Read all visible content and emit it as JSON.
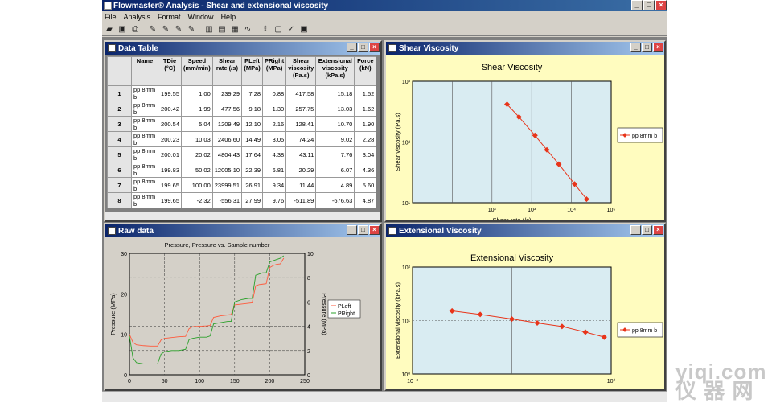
{
  "app": {
    "title": "Flowmaster® Analysis - Shear and extensional viscosity",
    "menu": [
      "File",
      "Analysis",
      "Format",
      "Window",
      "Help"
    ],
    "toolbar_icons": [
      "open-icon",
      "save-icon",
      "print-icon",
      "sep",
      "tool-a-icon",
      "tool-b-icon",
      "tool-c-icon",
      "tool-d-icon",
      "sep",
      "chart-icon",
      "table-icon",
      "grid-icon",
      "curves-icon",
      "sep",
      "export-icon",
      "dialog-icon",
      "check-icon",
      "disk-icon"
    ]
  },
  "data_table": {
    "title": "Data Table",
    "headers": [
      "",
      "Name",
      "TDie (°C)",
      "Speed (mm/min)",
      "Shear rate (/s)",
      "PLeft (MPa)",
      "PRight (MPa)",
      "Shear viscosity (Pa.s)",
      "Extensional viscosity (kPa.s)",
      "Force (kN)"
    ],
    "rows": [
      [
        "1",
        "pp 8mm b",
        "199.55",
        "1.00",
        "239.29",
        "7.28",
        "0.88",
        "417.58",
        "15.18",
        "1.52"
      ],
      [
        "2",
        "pp 8mm b",
        "200.42",
        "1.99",
        "477.56",
        "9.18",
        "1.30",
        "257.75",
        "13.03",
        "1.62"
      ],
      [
        "3",
        "pp 8mm b",
        "200.54",
        "5.04",
        "1209.49",
        "12.10",
        "2.16",
        "128.41",
        "10.70",
        "1.90"
      ],
      [
        "4",
        "pp 8mm b",
        "200.23",
        "10.03",
        "2406.60",
        "14.49",
        "3.05",
        "74.24",
        "9.02",
        "2.28"
      ],
      [
        "5",
        "pp 8mm b",
        "200.01",
        "20.02",
        "4804.43",
        "17.64",
        "4.38",
        "43.11",
        "7.76",
        "3.04"
      ],
      [
        "6",
        "pp 8mm b",
        "199.83",
        "50.02",
        "12005.10",
        "22.39",
        "6.81",
        "20.29",
        "6.07",
        "4.36"
      ],
      [
        "7",
        "pp 8mm b",
        "199.65",
        "100.00",
        "23999.51",
        "26.91",
        "9.34",
        "11.44",
        "4.89",
        "5.60"
      ],
      [
        "8",
        "pp 8mm b",
        "199.65",
        "-2.32",
        "-556.31",
        "27.99",
        "9.76",
        "-511.89",
        "-676.63",
        "4.87"
      ]
    ]
  },
  "shear_window": {
    "title": "Shear Viscosity"
  },
  "extensional_window": {
    "title": "Extensional Viscosity"
  },
  "raw_window": {
    "title": "Raw data"
  },
  "chart_data": [
    {
      "type": "scatter",
      "title": "Shear Viscosity",
      "xlabel": "Shear rate (/s)",
      "ylabel": "Shear viscosity (Pa.s)",
      "xscale": "log",
      "yscale": "log",
      "xlim": [
        1,
        100000
      ],
      "ylim": [
        10,
        1000
      ],
      "x_ticks": [
        "10²",
        "10³",
        "10⁴",
        "10⁵"
      ],
      "y_ticks": [
        "10³",
        "10²",
        "10¹"
      ],
      "series": [
        {
          "name": "pp 8mm b",
          "color": "#e8341a",
          "x": [
            239.29,
            477.56,
            1209.49,
            2406.6,
            4804.43,
            12005.1,
            23999.51
          ],
          "y": [
            417.58,
            257.75,
            128.41,
            74.24,
            43.11,
            20.29,
            11.44
          ]
        }
      ],
      "grid": true,
      "legend": "right",
      "background": "#fffcbf",
      "plot_bg": "#d9ecf2"
    },
    {
      "type": "scatter",
      "title": "Extensional Viscosity",
      "ylabel": "Extensional viscosity (kPa.s)",
      "xscale": "log",
      "yscale": "log",
      "xlim": [
        0.01,
        1
      ],
      "ylim": [
        1,
        100
      ],
      "x_ticks": [
        "10⁻²",
        "10⁰"
      ],
      "y_ticks": [
        "10²",
        "10¹",
        "10⁰"
      ],
      "series": [
        {
          "name": "pp 8mm b",
          "color": "#e8341a",
          "x": [
            0.025,
            0.048,
            0.1,
            0.18,
            0.32,
            0.55,
            0.85
          ],
          "y": [
            15.18,
            13.03,
            10.7,
            9.02,
            7.76,
            6.07,
            4.89
          ]
        }
      ],
      "grid": true,
      "legend": "right",
      "background": "#fffcbf",
      "plot_bg": "#d9ecf2"
    },
    {
      "type": "line",
      "title": "Pressure, Pressure vs. Sample number",
      "xlabel": "",
      "ylabel": "Pressure (MPa)",
      "y2label": "Pressure (MPa)",
      "xlim": [
        0,
        250
      ],
      "ylim": [
        0,
        30
      ],
      "y2lim": [
        0,
        10
      ],
      "x_ticks": [
        0,
        50,
        100,
        150,
        200,
        250
      ],
      "y_ticks": [
        0,
        10,
        20,
        30
      ],
      "y2_ticks": [
        0,
        2,
        4,
        6,
        8,
        10
      ],
      "series": [
        {
          "name": "PLeft",
          "color": "#ff5a3c",
          "axis": "left",
          "x": [
            0,
            5,
            10,
            20,
            30,
            40,
            45,
            50,
            60,
            70,
            80,
            85,
            90,
            100,
            110,
            115,
            120,
            130,
            140,
            145,
            150,
            160,
            170,
            175,
            180,
            185,
            190,
            195,
            200,
            205,
            210,
            215,
            220
          ],
          "y": [
            10,
            8,
            7.4,
            7.2,
            7.1,
            7.1,
            8.6,
            9.0,
            9.2,
            9.4,
            9.5,
            11.4,
            11.9,
            12.0,
            12.1,
            12.2,
            14.2,
            14.6,
            14.8,
            14.9,
            17.3,
            17.5,
            17.7,
            17.8,
            22.0,
            22.3,
            22.4,
            22.5,
            26.5,
            27.0,
            27.3,
            27.4,
            28.8
          ]
        },
        {
          "name": "PRight",
          "color": "#2aa02a",
          "axis": "right",
          "x": [
            0,
            5,
            10,
            20,
            30,
            40,
            45,
            50,
            60,
            70,
            80,
            85,
            90,
            100,
            110,
            115,
            120,
            130,
            140,
            145,
            150,
            160,
            170,
            175,
            180,
            185,
            190,
            195,
            200,
            205,
            210,
            215,
            220
          ],
          "y": [
            3.2,
            1.4,
            1.0,
            0.9,
            0.9,
            0.9,
            1.7,
            1.9,
            2.0,
            2.0,
            2.1,
            2.9,
            3.0,
            3.1,
            3.1,
            3.2,
            4.2,
            4.3,
            4.4,
            4.4,
            6.0,
            6.2,
            6.3,
            6.3,
            8.2,
            8.3,
            8.4,
            8.4,
            9.3,
            9.4,
            9.5,
            9.6,
            9.8
          ]
        }
      ],
      "grid": true,
      "legend": "right",
      "background": "#d4d0c8"
    }
  ],
  "watermark": {
    "line1": "yiqi.com",
    "line2": "仪 器 网"
  }
}
